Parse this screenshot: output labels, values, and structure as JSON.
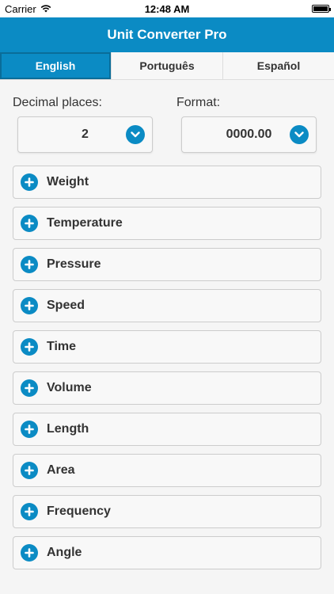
{
  "status_bar": {
    "carrier": "Carrier",
    "time": "12:48 AM"
  },
  "header": {
    "title": "Unit Converter Pro"
  },
  "tabs": [
    {
      "label": "English",
      "active": true
    },
    {
      "label": "Português",
      "active": false
    },
    {
      "label": "Español",
      "active": false
    }
  ],
  "settings": {
    "decimal": {
      "label": "Decimal places:",
      "value": "2"
    },
    "format": {
      "label": "Format:",
      "value": "0000.00"
    }
  },
  "categories": [
    {
      "label": "Weight"
    },
    {
      "label": "Temperature"
    },
    {
      "label": "Pressure"
    },
    {
      "label": "Speed"
    },
    {
      "label": "Time"
    },
    {
      "label": "Volume"
    },
    {
      "label": "Length"
    },
    {
      "label": "Area"
    },
    {
      "label": "Frequency"
    },
    {
      "label": "Angle"
    }
  ],
  "icons": {
    "expand": "plus-circle-icon",
    "dropdown": "chevron-down-circle-icon",
    "wifi": "wifi-icon",
    "battery": "battery-icon"
  },
  "colors": {
    "accent": "#0b8bc4"
  }
}
